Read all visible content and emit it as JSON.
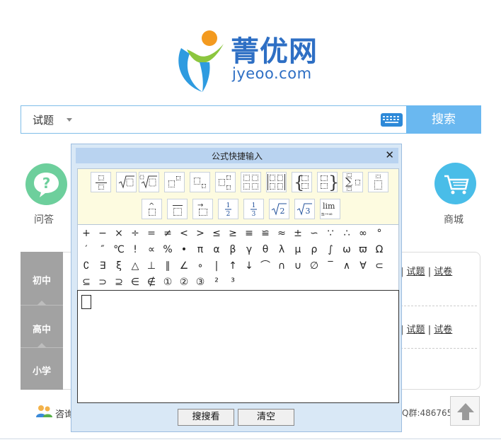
{
  "brand": {
    "name_cn": "菁优网",
    "name_en": "jyeoo.com",
    "colors": {
      "orange": "#f39a1f",
      "green": "#8cc63f",
      "blue": "#2e6fc4"
    }
  },
  "search": {
    "type_label": "试题",
    "button_label": "搜索",
    "keyboard_icon": "keyboard-icon"
  },
  "side": {
    "qa_label": "问答",
    "mall_label": "商城"
  },
  "grades": [
    "初中",
    "高中",
    "小学"
  ],
  "right_links": [
    {
      "a": "试题",
      "sep": "|",
      "b": "试卷"
    },
    {
      "a": "试题",
      "sep": "|",
      "b": "试卷"
    }
  ],
  "footer": {
    "consult": "咨询",
    "qq": "Q群:486765"
  },
  "formula": {
    "title": "公式快捷输入",
    "close": "✕",
    "template_texts": {
      "sum": "∑",
      "lim": "lim",
      "lim_sub": "n→∞",
      "half": "1/2",
      "third": "1/3",
      "sqrt2": "√2",
      "sqrt3": "√3"
    },
    "symbols": [
      [
        "+",
        "−",
        "×",
        "÷",
        "=",
        "≠",
        "<",
        ">",
        "≤",
        "≥",
        "≡",
        "≌",
        "≈",
        "±",
        "∽",
        "∵",
        "∴",
        "∞",
        "°"
      ],
      [
        "′",
        "″",
        "℃",
        "!",
        "∝",
        "%",
        "•",
        "π",
        "α",
        "β",
        "γ",
        "θ",
        "λ",
        "μ",
        "ρ",
        "∫",
        "ω",
        "ϖ",
        "Ω"
      ],
      [
        "∁",
        "∃",
        "ξ",
        "△",
        "⊥",
        "∥",
        "∠",
        "∘",
        "|",
        "↑",
        "↓",
        "⌒",
        "∩",
        "∪",
        "∅",
        "‾",
        "∧",
        "∀",
        "⊂"
      ],
      [
        "⊆",
        "⊃",
        "⊇",
        "∈",
        "∉",
        "①",
        "②",
        "③",
        "²",
        "³"
      ]
    ],
    "btn_search": "搜搜看",
    "btn_clear": "清空"
  }
}
